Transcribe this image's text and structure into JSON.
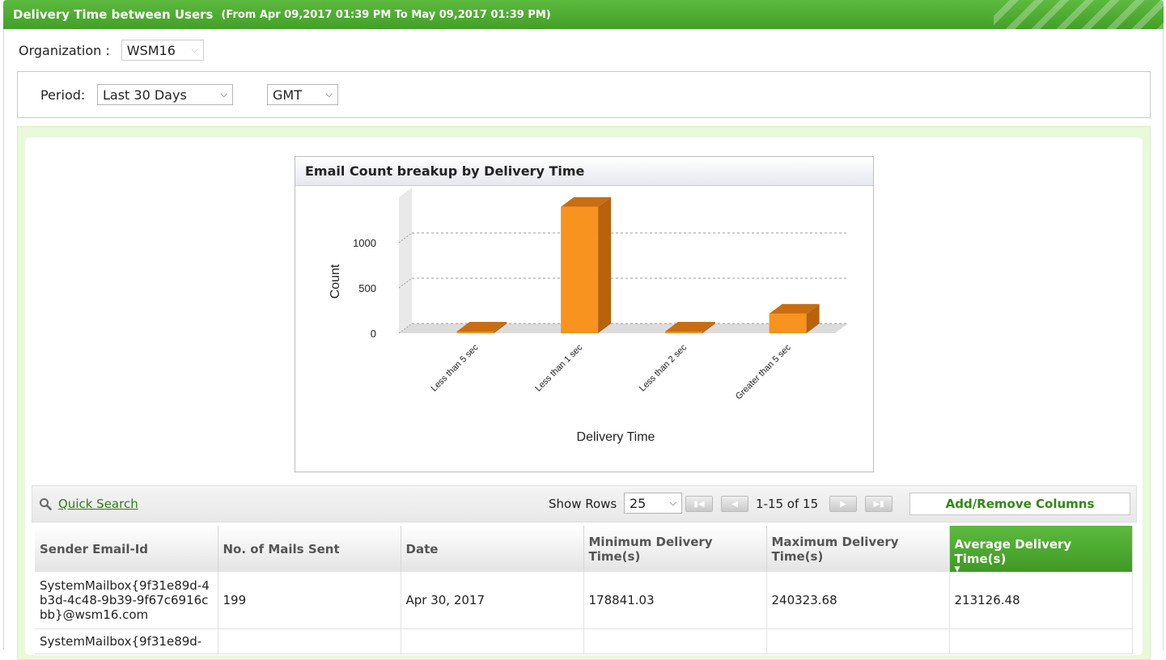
{
  "header": {
    "title": "Delivery Time between Users",
    "range": "(From Apr 09,2017 01:39 PM To May 09,2017 01:39 PM)"
  },
  "filters": {
    "org_label": "Organization :",
    "org_value": "WSM16",
    "period_label": "Period:",
    "period_value": "Last 30 Days",
    "tz_value": "GMT"
  },
  "chart_title": "Email Count breakup by Delivery Time",
  "chart_data": {
    "type": "bar",
    "title": "Email Count breakup by Delivery Time",
    "xlabel": "Delivery Time",
    "ylabel": "Count",
    "categories": [
      "Less than 5 sec",
      "Less than 1 sec",
      "Less than 2 sec",
      "Greater than 5 sec"
    ],
    "values": [
      1,
      1395,
      1,
      215
    ],
    "ylim": [
      0,
      1500
    ],
    "yticks": [
      0,
      500,
      1000
    ],
    "grid": true,
    "bar_color": "#f7931e"
  },
  "toolbar": {
    "quick_search": "Quick Search",
    "show_rows_label": "Show Rows",
    "rows_value": "25",
    "page_info": "1-15 of 15",
    "add_remove": "Add/Remove Columns"
  },
  "table": {
    "columns": [
      "Sender Email-Id",
      "No. of Mails Sent",
      "Date",
      "Minimum Delivery Time(s)",
      "Maximum Delivery Time(s)",
      "Average Delivery Time(s)"
    ],
    "rows": [
      {
        "sender": "SystemMailbox{9f31e89d-4b3d-4c48-9b39-9f67c6916cbb}@wsm16.com",
        "mails": "199",
        "date": "Apr 30, 2017",
        "min": "178841.03",
        "max": "240323.68",
        "avg": "213126.48"
      },
      {
        "sender": "SystemMailbox{9f31e89d-",
        "mails": "",
        "date": "",
        "min": "",
        "max": "",
        "avg": ""
      }
    ]
  },
  "colors": {
    "accent_green": "#43a027",
    "link_green": "#2f7d14",
    "bar_orange": "#f7931e"
  },
  "icons": {
    "search": "search-icon",
    "first": "first-page-icon",
    "prev": "prev-page-icon",
    "next": "next-page-icon",
    "last": "last-page-icon"
  }
}
